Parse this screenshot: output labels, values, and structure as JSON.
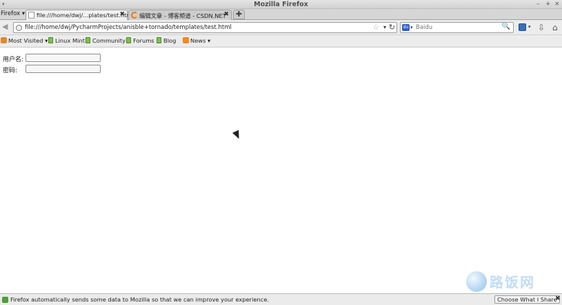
{
  "window": {
    "title": "Mozilla Firefox",
    "menu_arrow": "▾",
    "controls": [
      "–",
      "+",
      "×"
    ]
  },
  "tabs": {
    "firefox_menu": "Firefox ▾",
    "items": [
      {
        "label": "file:///home/dwj/...plates/test.html",
        "close": "✖",
        "icon": "page-icon"
      },
      {
        "label": "编辑文章 - 博客频道 - CSDN.NET",
        "close": "✖",
        "icon": "loading-spinner-icon"
      }
    ],
    "new_tab": "✚"
  },
  "navbar": {
    "back": "◀",
    "url": "file:///home/dwj/PycharmProjects/anisble+tornado/templates/test.html",
    "star": "☆",
    "dropdown": "▾",
    "reload": "↻",
    "search_placeholder": "Baidu",
    "search_engine_icon": "baidu-icon",
    "search_magnifier": "🔍",
    "download": "⇩",
    "home": "⌂"
  },
  "bookmarks": [
    {
      "label": "Most Visited ▾",
      "icon": "folder-icon"
    },
    {
      "label": "Linux Mint",
      "icon": "bookmark-icon"
    },
    {
      "label": "Community",
      "icon": "bookmark-icon"
    },
    {
      "label": "Forums",
      "icon": "bookmark-icon"
    },
    {
      "label": "Blog",
      "icon": "bookmark-icon"
    },
    {
      "label": "News ▾",
      "icon": "rss-icon"
    }
  ],
  "form": {
    "username_label": "用户名:",
    "username_value": "",
    "password_label": "密码:",
    "password_value": ""
  },
  "watermark": {
    "text": "路饭网"
  },
  "statusbar": {
    "message": "Firefox automatically sends some data to Mozilla so that we can improve your experience.",
    "share_button": "Choose What I Share",
    "close": "✖"
  },
  "colors": {
    "chrome": "#ececec",
    "tabbar": "#d6d6d6",
    "active_tab": "#f1f1f1",
    "content_bg": "#ffffff"
  }
}
